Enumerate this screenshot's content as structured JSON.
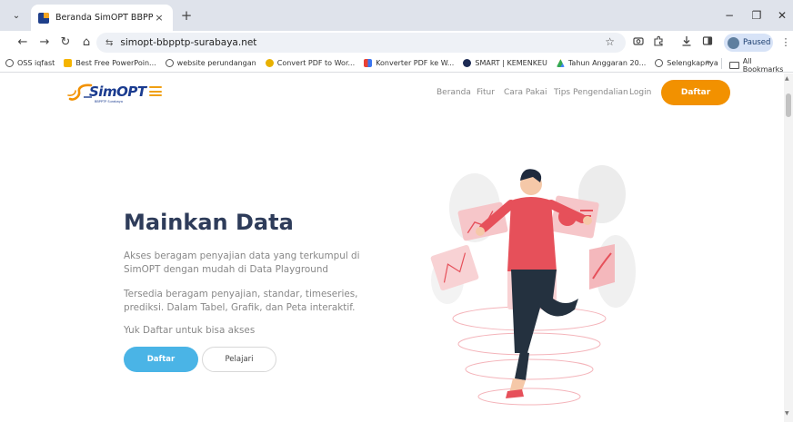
{
  "browser": {
    "tab": {
      "title": "Beranda SimOPT BBPPTP SBY",
      "close": "×"
    },
    "new_tab": "+",
    "window": {
      "minimize": "−",
      "maximize": "❐",
      "close": "✕"
    },
    "nav": {
      "back": "←",
      "forward": "→",
      "reload": "↻",
      "home": "⌂",
      "site_info": "⇆"
    },
    "url": "simopt-bbpptp-surabaya.net",
    "star": "☆",
    "profile_status": "Paused",
    "menu_dots": "⋮",
    "bookmarks": [
      {
        "label": "OSS iqfast",
        "icon": "globe-icon",
        "color": "#555555"
      },
      {
        "label": "Best Free PowerPoin...",
        "icon": "slides-icon",
        "color": "#f5b400"
      },
      {
        "label": "website perundangan",
        "icon": "globe-icon",
        "color": "#555555"
      },
      {
        "label": "Convert PDF to Wor...",
        "icon": "convert-icon",
        "color": "#e8b100"
      },
      {
        "label": "Konverter PDF ke W...",
        "icon": "pdf-icon",
        "color": "#3a75f0"
      },
      {
        "label": "SMART | KEMENKEU",
        "icon": "kemenkeu-icon",
        "color": "#1d2b54"
      },
      {
        "label": "Tahun Anggaran 20...",
        "icon": "drive-icon",
        "color": "#34a853"
      },
      {
        "label": "Selengkapnya",
        "icon": "globe-icon",
        "color": "#555555"
      }
    ],
    "bookmarks_more": "»",
    "all_bookmarks": "All Bookmarks"
  },
  "site": {
    "logo_text": "SimOPT",
    "logo_sub": "BBPPTP Surabaya",
    "menu": [
      "Beranda",
      "Fitur",
      "Cara Pakai",
      "Tips Pengendalian",
      "Login"
    ],
    "cta_top": "Daftar",
    "accent": "#f29100",
    "primary": "#4ab4e6"
  },
  "hero": {
    "title": "Mainkan Data",
    "paragraph1": "Akses beragam penyajian data yang terkumpul di SimOPT dengan mudah di Data Playground",
    "paragraph2": "Tersedia beragam penyajian, standar, timeseries, prediksi. Dalam Tabel, Grafik, dan Peta interaktif.",
    "paragraph3": "Yuk Daftar untuk bisa akses",
    "button_primary": "Daftar",
    "button_secondary": "Pelajari"
  }
}
